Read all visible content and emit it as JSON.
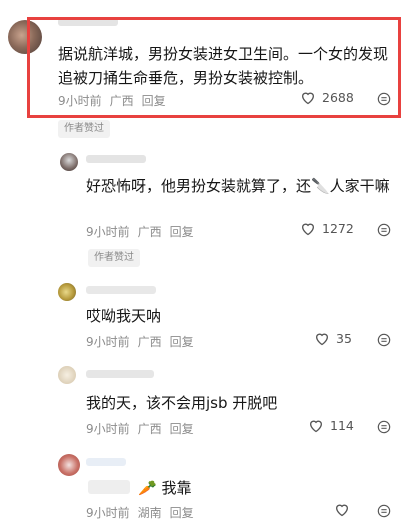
{
  "comments": [
    {
      "text": "据说航洋城，男扮女装进女卫生间。一个女的发现追被刀捅生命垂危，男扮女装被控制。",
      "time": "9小时前",
      "location": "广西",
      "reply_label": "回复",
      "likes": "2688",
      "badge": "作者赞过"
    },
    {
      "text": "好恐怖呀，他男扮女装就算了，还🔪人家干嘛",
      "time": "9小时前",
      "location": "广西",
      "reply_label": "回复",
      "likes": "1272",
      "badge": "作者赞过"
    },
    {
      "text": "哎呦我天呐",
      "time": "9小时前",
      "location": "广西",
      "reply_label": "回复",
      "likes": "35"
    },
    {
      "text": "我的天，该不会用jsb 开脱吧",
      "time": "9小时前",
      "location": "广西",
      "reply_label": "回复",
      "likes": "114"
    },
    {
      "text": "🥕 我靠",
      "time": "9小时前",
      "location": "湖南",
      "reply_label": "回复",
      "likes": ""
    }
  ],
  "icons": {
    "like": "heart-outline-icon",
    "more": "more-circle-icon",
    "knife": "knife-emoji",
    "carrot": "carrot-emoji"
  },
  "colors": {
    "highlight_border": "#e8413f",
    "meta_text": "#8c8c8c"
  }
}
